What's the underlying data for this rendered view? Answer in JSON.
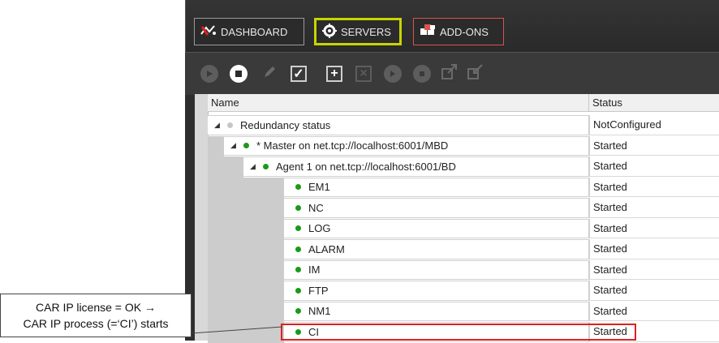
{
  "nav": {
    "dashboard_label": "DASHBOARD",
    "servers_label": "SERVERS",
    "addons_label": "ADD-ONS"
  },
  "table": {
    "headers": {
      "name": "Name",
      "status": "Status"
    },
    "rows": [
      {
        "name": "Redundancy status",
        "status": "NotConfigured"
      },
      {
        "name": "* Master on net.tcp://localhost:6001/MBD",
        "status": "Started"
      },
      {
        "name": "Agent 1 on net.tcp://localhost:6001/BD",
        "status": "Started"
      },
      {
        "name": "EM1",
        "status": "Started"
      },
      {
        "name": "NC",
        "status": "Started"
      },
      {
        "name": "LOG",
        "status": "Started"
      },
      {
        "name": "ALARM",
        "status": "Started"
      },
      {
        "name": "IM",
        "status": "Started"
      },
      {
        "name": "FTP",
        "status": "Started"
      },
      {
        "name": "NM1",
        "status": "Started"
      },
      {
        "name": "CI",
        "status": "Started"
      }
    ]
  },
  "callout": {
    "line1": "CAR IP license = OK →",
    "line2": "CAR IP process (=‘CI’) starts"
  },
  "colors": {
    "status_ok": "#1a9a1a",
    "highlight": "#e02020",
    "active_tab": "#c8d400"
  }
}
